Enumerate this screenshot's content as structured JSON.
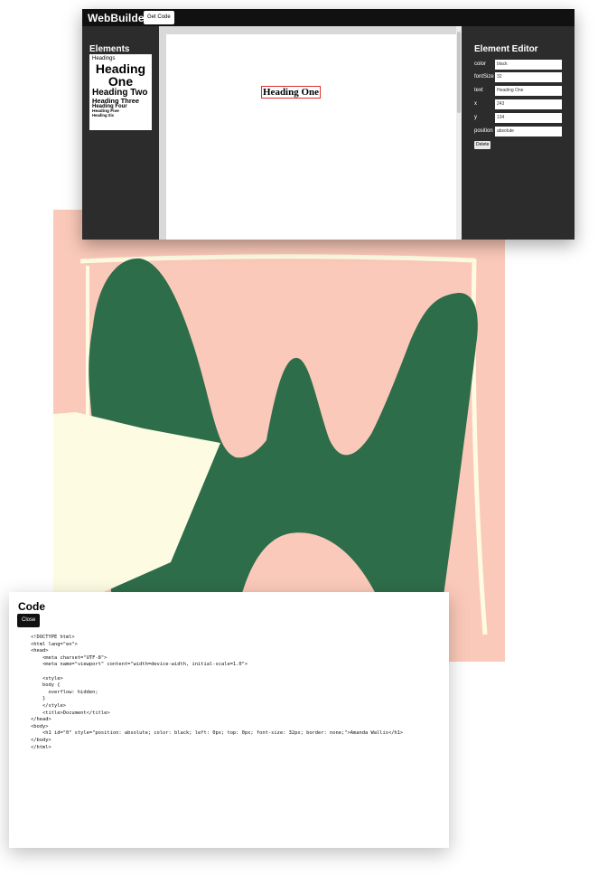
{
  "app": {
    "name": "WebBuilder",
    "get_code_label": "Get Code"
  },
  "elements_panel": {
    "title": "Elements",
    "items": [
      "Headings",
      "Heading One",
      "Heading Two",
      "Heading Three",
      "Heading Four",
      "Heading Five",
      "Heading Six"
    ]
  },
  "canvas": {
    "selected_element_text": "Heading One"
  },
  "editor": {
    "title": "Element Editor",
    "fields": [
      {
        "label": "color",
        "value": "black"
      },
      {
        "label": "fontSize",
        "value": "32"
      },
      {
        "label": "text",
        "value": "Heading One"
      },
      {
        "label": "x",
        "value": "243"
      },
      {
        "label": "y",
        "value": "134"
      },
      {
        "label": "position",
        "value": "absolute"
      }
    ],
    "delete_label": "Delete"
  },
  "colors": {
    "topbar": "#111111",
    "panel": "#2c2c2c",
    "selection_border": "#e03030",
    "art_background": "#fbc9b9",
    "art_green": "#2e6d4a",
    "art_cream": "#fdfbe2"
  },
  "code_modal": {
    "title": "Code",
    "close_label": "Close",
    "code": "<!DOCTYPE html>\n<html lang=\"en\">\n<head>\n    <meta charset=\"UTF-8\">\n    <meta name=\"viewport\" content=\"width=device-width, initial-scale=1.0\">\n\n    <style>\n    body {\n      overflow: hidden;\n    }\n    </style>\n    <title>Document</title>\n</head>\n<body>\n    <h1 id=\"0\" style=\"position: absolute; color: black; left: 0px; top: 0px; font-size: 32px; border: none;\">Amanda Wallis</h1>\n</body>\n</html>"
  }
}
